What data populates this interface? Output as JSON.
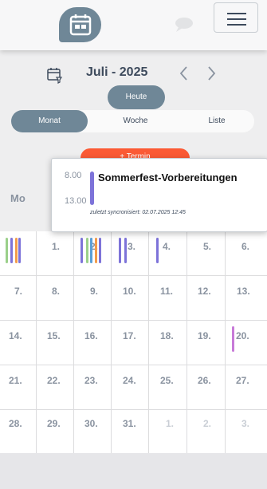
{
  "header": {
    "menu_label": "menu"
  },
  "calendar": {
    "month_title": "Juli - 2025",
    "today_label": "Heute",
    "views": [
      "Monat",
      "Woche",
      "Liste"
    ],
    "active_view": "Monat",
    "add_label": "+ Termin",
    "weekdays": [
      "Mo"
    ],
    "weeks": [
      [
        "",
        "1.",
        "2.",
        "3.",
        "4.",
        "5.",
        "6."
      ],
      [
        "7.",
        "8.",
        "9.",
        "10.",
        "11.",
        "12.",
        "13."
      ],
      [
        "14.",
        "15.",
        "16.",
        "17.",
        "18.",
        "19.",
        "20."
      ],
      [
        "21.",
        "22.",
        "23.",
        "24.",
        "25.",
        "26.",
        "27."
      ],
      [
        "28.",
        "29.",
        "30.",
        "31.",
        "1.",
        "2.",
        "3."
      ]
    ],
    "event_colors": {
      "purple": "#7d73d9",
      "green": "#9bd08a",
      "orange": "#f39c4a",
      "blue": "#5aa0d8",
      "magenta": "#c77ad8"
    }
  },
  "popup": {
    "start_time": "8.00",
    "end_time": "13.00",
    "title": "Sommerfest-Vorbereitungen",
    "sync_text": "zuletzt syncronisiert: 02.07.2025 12:45"
  }
}
